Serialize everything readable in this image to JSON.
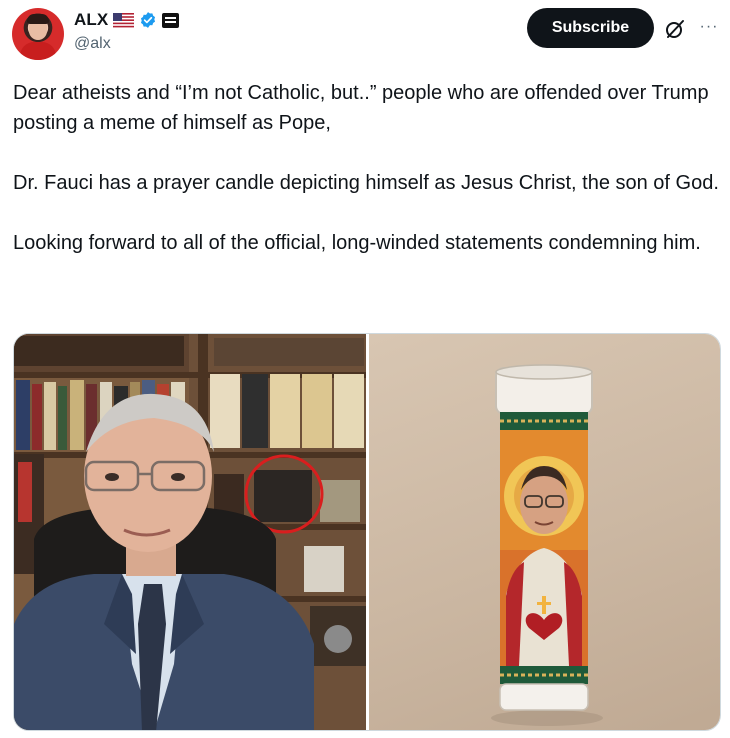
{
  "author": {
    "display_name": "ALX",
    "handle": "@alx",
    "flag_icon": "us-flag-icon",
    "verified_icon": "verified-badge-icon",
    "affiliation_icon": "affiliate-badge-icon"
  },
  "actions": {
    "subscribe_label": "Subscribe",
    "grok_icon": "grok-icon",
    "more_label": "···"
  },
  "tweet": {
    "paragraphs": [
      "Dear atheists and “I’m not Catholic, but..” people who are offended over Trump posting a meme of himself as Pope,",
      "Dr. Fauci has a prayer candle depicting himself as Jesus Christ, the son of God.",
      "Looking forward to all of the official, long-winded statements condemning him."
    ]
  },
  "colors": {
    "text": "#0f1419",
    "secondary": "#536471",
    "verified_blue": "#1d9bf0",
    "button_bg": "#0f1419",
    "border": "#cfd9de"
  }
}
